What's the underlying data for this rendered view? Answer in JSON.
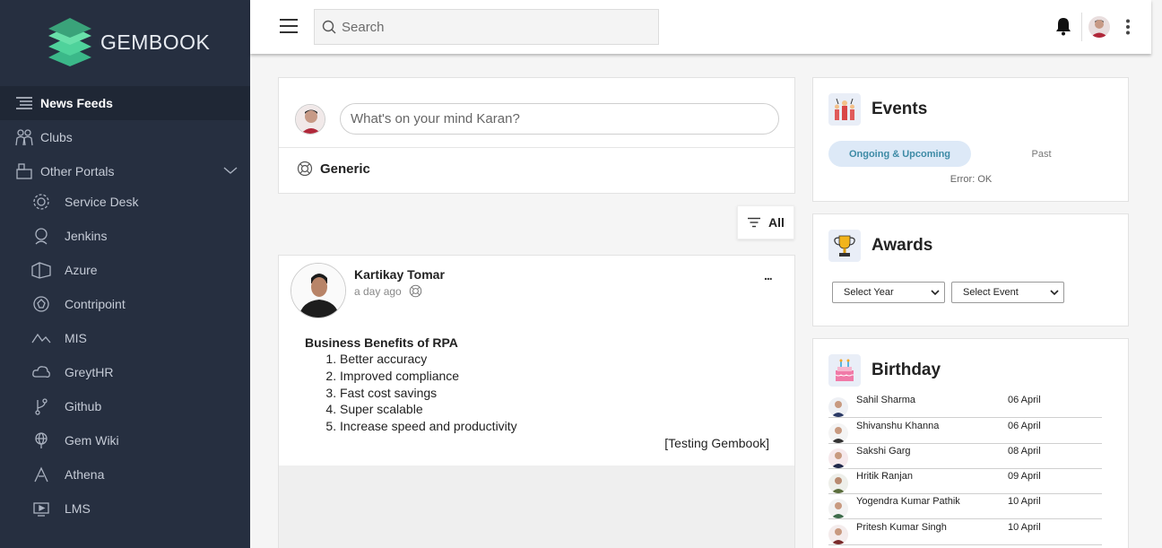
{
  "app": {
    "name": "GEMBOOK"
  },
  "sidebar": {
    "items": [
      {
        "label": "News Feeds",
        "icon": "news-feed-icon",
        "active": true
      },
      {
        "label": "Clubs",
        "icon": "clubs-icon"
      },
      {
        "label": "Other Portals",
        "icon": "portals-icon",
        "expanded": true
      },
      {
        "label": "Service Desk",
        "icon": "service-desk-icon"
      },
      {
        "label": "Jenkins",
        "icon": "jenkins-icon"
      },
      {
        "label": "Azure",
        "icon": "azure-icon"
      },
      {
        "label": "Contripoint",
        "icon": "contripoint-icon"
      },
      {
        "label": "MIS",
        "icon": "mis-icon"
      },
      {
        "label": "GreytHR",
        "icon": "greythr-icon"
      },
      {
        "label": "Github",
        "icon": "github-icon"
      },
      {
        "label": "Gem Wiki",
        "icon": "gem-wiki-icon"
      },
      {
        "label": "Athena",
        "icon": "athena-icon"
      },
      {
        "label": "LMS",
        "icon": "lms-icon"
      }
    ]
  },
  "topbar": {
    "search_placeholder": "Search"
  },
  "composer": {
    "placeholder": "What's on your mind Karan?",
    "channel": "Generic"
  },
  "feed_filter": {
    "label": "All"
  },
  "post": {
    "author": "Kartikay Tomar",
    "time": "a day ago",
    "title": "Business Benefits of RPA",
    "items": [
      "Better accuracy",
      "Improved compliance",
      "Fast cost savings",
      "Super scalable",
      "Increase speed and productivity"
    ],
    "signature": "[Testing Gembook]",
    "more": "..."
  },
  "events": {
    "title": "Events",
    "tab_active": "Ongoing & Upcoming",
    "tab_inactive": "Past",
    "message": "Error: OK"
  },
  "awards": {
    "title": "Awards",
    "year_select": "Select Year",
    "event_select": "Select Event"
  },
  "birthday": {
    "title": "Birthday",
    "people": [
      {
        "name": "Sahil Sharma",
        "date": "06 April"
      },
      {
        "name": "Shivanshu Khanna",
        "date": "06 April"
      },
      {
        "name": "Sakshi Garg",
        "date": "08 April"
      },
      {
        "name": "Hritik Ranjan",
        "date": "09 April"
      },
      {
        "name": "Yogendra Kumar Pathik",
        "date": "10 April"
      },
      {
        "name": "Pritesh Kumar Singh",
        "date": "10 April"
      }
    ]
  },
  "colors": {
    "sidebar_bg": "#262f40",
    "sidebar_active": "#1f2735",
    "logo_green": "#3cbf8a",
    "tab_active_bg": "#dde9f7",
    "tab_active_text": "#3e8ba6"
  }
}
